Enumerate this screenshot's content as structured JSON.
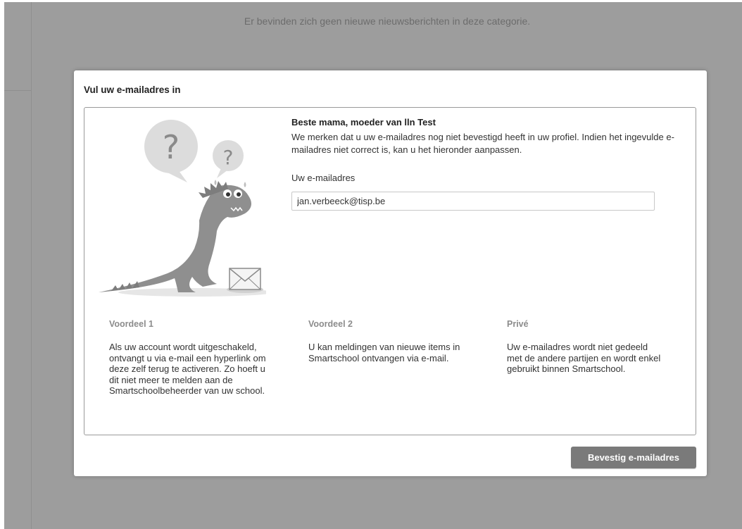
{
  "background": {
    "empty_news_text": "Er bevinden zich geen nieuwe nieuwsberichten in deze categorie."
  },
  "modal": {
    "title": "Vul uw e-mailadres in",
    "greeting": "Beste mama, moeder van lln Test",
    "intro": "We merken dat u uw e-mailadres nog niet bevestigd heeft in uw profiel. Indien het ingevulde e-mailadres niet correct is, kan u het hieronder aanpassen.",
    "email_label": "Uw e-mailadres",
    "email_value": "jan.verbeeck@tisp.be",
    "illustration": {
      "icons": [
        "dinosaur-illustration",
        "question-mark-bubble-icon",
        "envelope-icon"
      ]
    },
    "benefits": [
      {
        "title": "Voordeel 1",
        "text": "Als uw account wordt uitgeschakeld, ontvangt u via e-mail een hyperlink om deze zelf terug te activeren. Zo hoeft u dit niet meer te melden aan de Smartschoolbeheerder van uw school."
      },
      {
        "title": "Voordeel 2",
        "text": "U kan meldingen van nieuwe items in Smartschool ontvangen via e-mail."
      },
      {
        "title": "Privé",
        "text": "Uw e-mailadres wordt niet gedeeld met de andere partijen en wordt enkel gebruikt binnen Smartschool."
      }
    ],
    "confirm_label": "Bevestig e-mailadres"
  },
  "colors": {
    "overlay": "#a8a8a8",
    "button": "#7a7a7a",
    "benefit_title": "#8c8c8c"
  }
}
